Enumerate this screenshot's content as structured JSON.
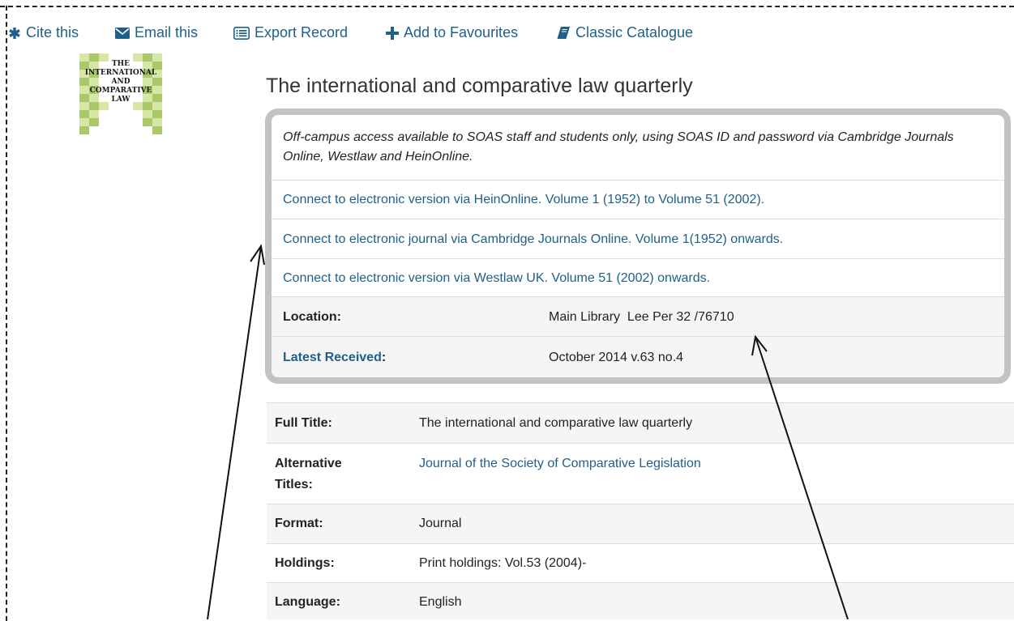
{
  "toolbar": {
    "cite": "Cite this",
    "email": "Email this",
    "export": "Export Record",
    "favourites": "Add to Favourites",
    "classic": "Classic Catalogue"
  },
  "icons": {
    "cite": "asterisk-icon",
    "email": "envelope-icon",
    "export": "list-icon",
    "favourites": "plus-icon",
    "classic": "book-icon"
  },
  "cover": {
    "lines": [
      "THE",
      "INTERNATIONAL",
      "AND",
      "COMPARATIVE",
      "LAW"
    ],
    "colors": {
      "light": "#d8e6a8",
      "dark": "#a9c96a"
    }
  },
  "record": {
    "title": "The international and comparative law quarterly"
  },
  "access": {
    "note": "Off-campus access available to SOAS staff and students only, using SOAS ID and password via Cambridge Journals Online, Westlaw and HeinOnline.",
    "links": [
      "Connect to electronic version via HeinOnline. Volume 1 (1952) to Volume 51 (2002).",
      "Connect to electronic journal via Cambridge Journals Online. Volume 1(1952) onwards.",
      "Connect to electronic version via Westlaw UK. Volume 51 (2002) onwards."
    ],
    "location_label": "Location:",
    "location_value": "Main Library  Lee Per 32 /76710",
    "latest_label": "Latest Received",
    "latest_colon": ":",
    "latest_value": "October 2014 v.63 no.4"
  },
  "details": [
    {
      "label": "Full Title:",
      "value": "The international and comparative law quarterly"
    },
    {
      "label": "Alternative Titles:",
      "value": "Journal of the Society of Comparative Legislation"
    },
    {
      "label": "Format:",
      "value": "Journal"
    },
    {
      "label": "Holdings:",
      "value": "Print holdings: Vol.53 (2004)-"
    },
    {
      "label": "Language:",
      "value": "English"
    }
  ],
  "colors": {
    "link": "#1f5f88",
    "box_border": "#c3c3c3",
    "row_shade": "#f5f5f5",
    "divider": "#dddddd"
  }
}
